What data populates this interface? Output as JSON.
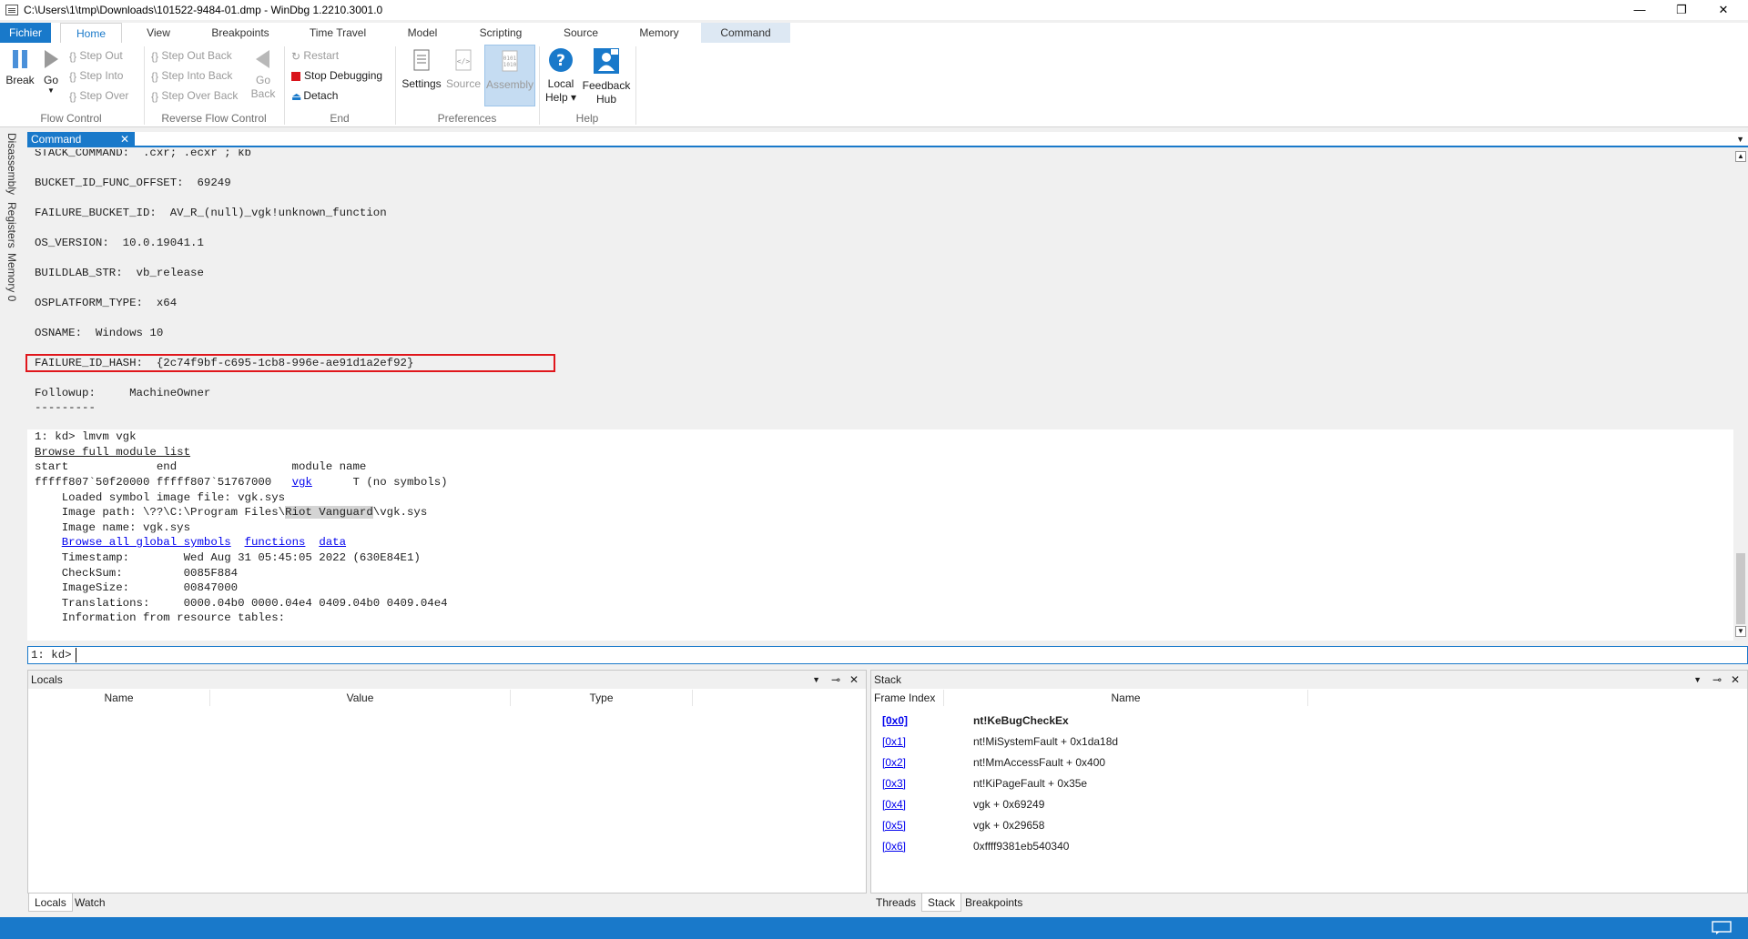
{
  "window": {
    "title": "C:\\Users\\1\\tmp\\Downloads\\101522-9484-01.dmp - WinDbg 1.2210.3001.0",
    "minimize": "—",
    "maximize": "❐",
    "close": "✕"
  },
  "ribbon_tabs": {
    "file": "Fichier",
    "home": "Home",
    "view": "View",
    "breakpoints": "Breakpoints",
    "time_travel": "Time Travel",
    "model": "Model",
    "scripting": "Scripting",
    "source": "Source",
    "memory": "Memory",
    "command": "Command"
  },
  "ribbon": {
    "flow_control": {
      "label": "Flow Control",
      "break": "Break",
      "go": "Go",
      "step_out": "Step Out",
      "step_into": "Step Into",
      "step_over": "Step Over"
    },
    "reverse_flow": {
      "label": "Reverse Flow Control",
      "step_out_back": "Step Out Back",
      "step_into_back": "Step Into Back",
      "step_over_back": "Step Over Back",
      "go_back": "Go\nBack",
      "go_back_l1": "Go",
      "go_back_l2": "Back"
    },
    "end": {
      "label": "End",
      "restart": "Restart",
      "stop_debugging": "Stop Debugging",
      "detach": "Detach"
    },
    "preferences": {
      "label": "Preferences",
      "settings": "Settings",
      "source": "Source",
      "assembly": "Assembly"
    },
    "help": {
      "label": "Help",
      "local_help_l1": "Local",
      "local_help_l2": "Help ▾",
      "feedback_l1": "Feedback",
      "feedback_l2": "Hub"
    }
  },
  "side_tabs": {
    "disassembly": "Disassembly",
    "registers": "Registers",
    "memory0": "Memory 0"
  },
  "command_window": {
    "tab_label": "Command",
    "close": "✕",
    "lines": {
      "l0": "STACK_COMMAND:  .cxr; .ecxr ; kb",
      "l1": "BUCKET_ID_FUNC_OFFSET:  69249",
      "l2": "FAILURE_BUCKET_ID:  AV_R_(null)_vgk!unknown_function",
      "l3": "OS_VERSION:  10.0.19041.1",
      "l4": "BUILDLAB_STR:  vb_release",
      "l5": "OSPLATFORM_TYPE:  x64",
      "l6": "OSNAME:  Windows 10",
      "l7": "FAILURE_ID_HASH:  {2c74f9bf-c695-1cb8-996e-ae91d1a2ef92}",
      "l8": "Followup:     MachineOwner",
      "l9": "---------",
      "l10": "1: kd> lmvm vgk",
      "l11_link": "Browse full module list",
      "l12": "start             end                 module name",
      "l13a": "fffff807`50f20000 fffff807`51767000   ",
      "l13_link": "vgk",
      "l13b": "      T (no symbols)",
      "l14": "    Loaded symbol image file: vgk.sys",
      "l15a": "    Image path: \\??\\C:\\Program Files\\",
      "l15_hl": "Riot Vanguard",
      "l15b": "\\vgk.sys",
      "l16": "    Image name: vgk.sys",
      "l17_link1": "Browse all global symbols",
      "l17_link2": "functions",
      "l17_link3": "data",
      "l18": "    Timestamp:        Wed Aug 31 05:45:05 2022 (630E84E1)",
      "l19": "    CheckSum:         0085F884",
      "l20": "    ImageSize:        00847000",
      "l21": "    Translations:     0000.04b0 0000.04e4 0409.04b0 0409.04e4",
      "l22": "    Information from resource tables:"
    },
    "prompt": "1: kd>"
  },
  "locals_panel": {
    "title": "Locals",
    "columns": [
      "Name",
      "Value",
      "Type"
    ]
  },
  "stack_panel": {
    "title": "Stack",
    "columns": [
      "Frame Index",
      "Name"
    ],
    "frames": [
      {
        "index": "[0x0]",
        "name": "nt!KeBugCheckEx"
      },
      {
        "index": "[0x1]",
        "name": "nt!MiSystemFault + 0x1da18d"
      },
      {
        "index": "[0x2]",
        "name": "nt!MmAccessFault + 0x400"
      },
      {
        "index": "[0x3]",
        "name": "nt!KiPageFault + 0x35e"
      },
      {
        "index": "[0x4]",
        "name": "vgk + 0x69249"
      },
      {
        "index": "[0x5]",
        "name": "vgk + 0x29658"
      },
      {
        "index": "[0x6]",
        "name": "0xffff9381eb540340"
      }
    ]
  },
  "bottom_tabs_left": {
    "locals": "Locals",
    "watch": "Watch"
  },
  "bottom_tabs_right": {
    "threads": "Threads",
    "stack": "Stack",
    "breakpoints": "Breakpoints"
  },
  "colors": {
    "accent": "#1979ca",
    "highlight_box": "#e0161c",
    "link": "#0000ee"
  }
}
